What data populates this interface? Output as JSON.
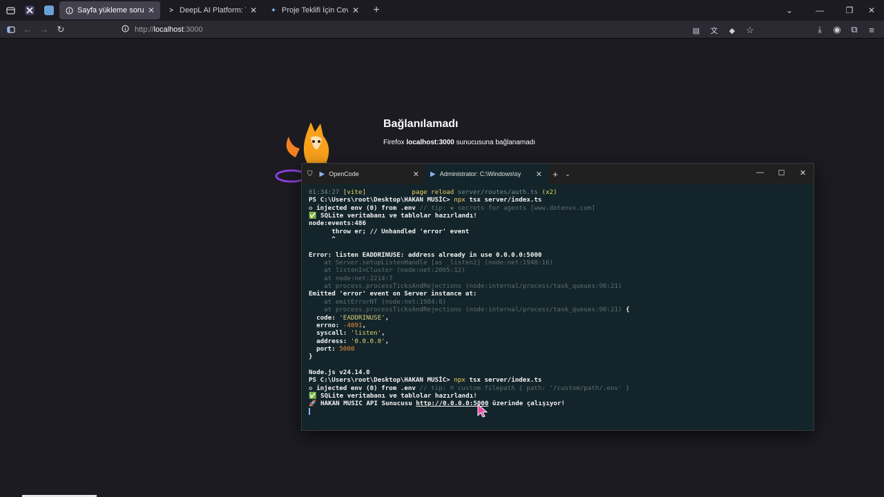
{
  "browser": {
    "tabs": [
      {
        "label": "Sayfa yükleme sorunu",
        "active": true
      },
      {
        "label": "DeepL AI Platform: Translation,",
        "active": false
      },
      {
        "label": "Proje Teklifi İçin Cevap Senaryol",
        "active": false
      }
    ],
    "url_prefix": "http://",
    "url_host": "localhost",
    "url_rest": ":3000"
  },
  "page": {
    "title": "Bağlanılamadı",
    "desc_prefix": "Firefox ",
    "desc_host": "localhost:3000",
    "desc_suffix": " sunucusuna bağlanamadı"
  },
  "terminal": {
    "tabs": [
      {
        "label": "OpenCode"
      },
      {
        "label": "Administrator:  C:\\Windows\\sy"
      }
    ],
    "lines": [
      [
        {
          "t": "01:34:27 ",
          "c": "c-dim"
        },
        {
          "t": "[vite]",
          "c": "c-yel"
        },
        {
          "t": "            ",
          "c": "c-norm"
        },
        {
          "t": "page reload ",
          "c": "c-yel"
        },
        {
          "t": "server/routes/auth.ts",
          "c": "c-dim"
        },
        {
          "t": " (x2)",
          "c": "c-yel"
        }
      ],
      [
        {
          "t": "PS C:\\Users\\root\\Desktop\\HAKAN MUSİC> ",
          "c": "c-wht"
        },
        {
          "t": "npx ",
          "c": "c-yel"
        },
        {
          "t": "tsx server/index.ts",
          "c": "c-wht"
        }
      ],
      [
        {
          "t": "◇ injected env (0) from .env ",
          "c": "c-wht"
        },
        {
          "t": "// tip: ◈ secrets for agents [www.dotenvx.com]",
          "c": "c-faint"
        }
      ],
      [
        {
          "t": "✅ SQLite veritabanı ve tablolar hazırlandı!",
          "c": "c-wht"
        }
      ],
      [
        {
          "t": "node:events:486",
          "c": "c-wht"
        }
      ],
      [
        {
          "t": "      throw er; // Unhandled 'error' event",
          "c": "c-wht"
        }
      ],
      [
        {
          "t": "      ^",
          "c": "c-wht"
        }
      ],
      [
        {
          "t": "",
          "c": "c-norm"
        }
      ],
      [
        {
          "t": "Error: listen EADDRINUSE: address already in use 0.0.0.0:5000",
          "c": "c-wht"
        }
      ],
      [
        {
          "t": "    at Server.setupListenHandle [as _listen2] (node:net:1948:16)",
          "c": "c-faint"
        }
      ],
      [
        {
          "t": "    at listenInCluster (node:net:2005:12)",
          "c": "c-faint"
        }
      ],
      [
        {
          "t": "    at node:net:2214:7",
          "c": "c-faint"
        }
      ],
      [
        {
          "t": "    at process.processTicksAndRejections (node:internal/process/task_queues:90:21)",
          "c": "c-faint"
        }
      ],
      [
        {
          "t": "Emitted 'error' event on Server instance at:",
          "c": "c-wht"
        }
      ],
      [
        {
          "t": "    at emitErrorNT (node:net:1984:8)",
          "c": "c-faint"
        }
      ],
      [
        {
          "t": "    at process.processTicksAndRejections (node:internal/process/task_queues:90:21)",
          "c": "c-faint"
        },
        {
          "t": " {",
          "c": "c-wht"
        }
      ],
      [
        {
          "t": "  code: ",
          "c": "c-wht"
        },
        {
          "t": "'EADDRINUSE'",
          "c": "c-grn"
        },
        {
          "t": ",",
          "c": "c-wht"
        }
      ],
      [
        {
          "t": "  errno: ",
          "c": "c-wht"
        },
        {
          "t": "-4091",
          "c": "c-orn"
        },
        {
          "t": ",",
          "c": "c-wht"
        }
      ],
      [
        {
          "t": "  syscall: ",
          "c": "c-wht"
        },
        {
          "t": "'listen'",
          "c": "c-grn"
        },
        {
          "t": ",",
          "c": "c-wht"
        }
      ],
      [
        {
          "t": "  address: ",
          "c": "c-wht"
        },
        {
          "t": "'0.0.0.0'",
          "c": "c-grn"
        },
        {
          "t": ",",
          "c": "c-wht"
        }
      ],
      [
        {
          "t": "  port: ",
          "c": "c-wht"
        },
        {
          "t": "5000",
          "c": "c-orn"
        }
      ],
      [
        {
          "t": "}",
          "c": "c-wht"
        }
      ],
      [
        {
          "t": "",
          "c": "c-norm"
        }
      ],
      [
        {
          "t": "Node.js v24.14.0",
          "c": "c-wht"
        }
      ],
      [
        {
          "t": "PS C:\\Users\\root\\Desktop\\HAKAN MUSİC> ",
          "c": "c-wht"
        },
        {
          "t": "npx ",
          "c": "c-yel"
        },
        {
          "t": "tsx server/index.ts",
          "c": "c-wht"
        }
      ],
      [
        {
          "t": "◇ injected env (0) from .env ",
          "c": "c-wht"
        },
        {
          "t": "// tip: ⌘ custom filepath { path: '/custom/path/.env' }",
          "c": "c-faint"
        }
      ],
      [
        {
          "t": "✅ SQLite veritabanı ve tablolar hazırlandı!",
          "c": "c-wht"
        }
      ],
      [
        {
          "t": "🚀 HAKAN MUSIC API Sunucusu ",
          "c": "c-wht"
        },
        {
          "t": "http://0.0.0.0:5000",
          "c": "c-link"
        },
        {
          "t": " üzerinde çalışıyor!",
          "c": "c-wht"
        }
      ]
    ]
  }
}
